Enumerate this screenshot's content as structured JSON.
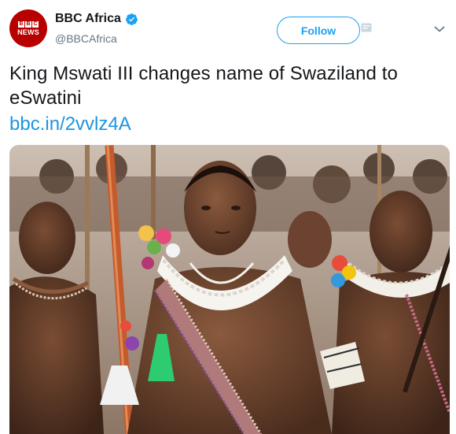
{
  "account": {
    "avatar": {
      "brand_letters": [
        "B",
        "B",
        "C"
      ],
      "brand_word": "NEWS",
      "color": "#b80000"
    },
    "display_name": "BBC Africa",
    "handle": "@BBCAfrica",
    "verified": true
  },
  "actions": {
    "follow_label": "Follow"
  },
  "tweet": {
    "text": "King Mswati III changes name of Swaziland to eSwatini",
    "link": "bbc.in/2vvlz4A"
  },
  "colors": {
    "link_blue": "#1b95e0",
    "follow_blue": "#1da1f2"
  }
}
